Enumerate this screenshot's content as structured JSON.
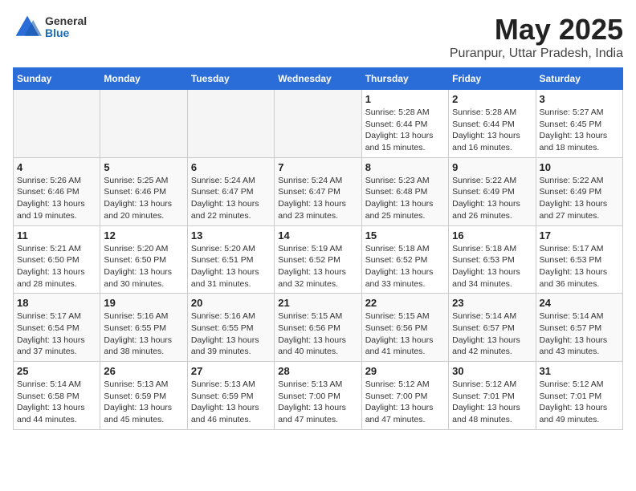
{
  "header": {
    "logo_general": "General",
    "logo_blue": "Blue",
    "month": "May 2025",
    "location": "Puranpur, Uttar Pradesh, India"
  },
  "weekdays": [
    "Sunday",
    "Monday",
    "Tuesday",
    "Wednesday",
    "Thursday",
    "Friday",
    "Saturday"
  ],
  "weeks": [
    [
      {
        "day": "",
        "info": ""
      },
      {
        "day": "",
        "info": ""
      },
      {
        "day": "",
        "info": ""
      },
      {
        "day": "",
        "info": ""
      },
      {
        "day": "1",
        "info": "Sunrise: 5:28 AM\nSunset: 6:44 PM\nDaylight: 13 hours\nand 15 minutes."
      },
      {
        "day": "2",
        "info": "Sunrise: 5:28 AM\nSunset: 6:44 PM\nDaylight: 13 hours\nand 16 minutes."
      },
      {
        "day": "3",
        "info": "Sunrise: 5:27 AM\nSunset: 6:45 PM\nDaylight: 13 hours\nand 18 minutes."
      }
    ],
    [
      {
        "day": "4",
        "info": "Sunrise: 5:26 AM\nSunset: 6:46 PM\nDaylight: 13 hours\nand 19 minutes."
      },
      {
        "day": "5",
        "info": "Sunrise: 5:25 AM\nSunset: 6:46 PM\nDaylight: 13 hours\nand 20 minutes."
      },
      {
        "day": "6",
        "info": "Sunrise: 5:24 AM\nSunset: 6:47 PM\nDaylight: 13 hours\nand 22 minutes."
      },
      {
        "day": "7",
        "info": "Sunrise: 5:24 AM\nSunset: 6:47 PM\nDaylight: 13 hours\nand 23 minutes."
      },
      {
        "day": "8",
        "info": "Sunrise: 5:23 AM\nSunset: 6:48 PM\nDaylight: 13 hours\nand 25 minutes."
      },
      {
        "day": "9",
        "info": "Sunrise: 5:22 AM\nSunset: 6:49 PM\nDaylight: 13 hours\nand 26 minutes."
      },
      {
        "day": "10",
        "info": "Sunrise: 5:22 AM\nSunset: 6:49 PM\nDaylight: 13 hours\nand 27 minutes."
      }
    ],
    [
      {
        "day": "11",
        "info": "Sunrise: 5:21 AM\nSunset: 6:50 PM\nDaylight: 13 hours\nand 28 minutes."
      },
      {
        "day": "12",
        "info": "Sunrise: 5:20 AM\nSunset: 6:50 PM\nDaylight: 13 hours\nand 30 minutes."
      },
      {
        "day": "13",
        "info": "Sunrise: 5:20 AM\nSunset: 6:51 PM\nDaylight: 13 hours\nand 31 minutes."
      },
      {
        "day": "14",
        "info": "Sunrise: 5:19 AM\nSunset: 6:52 PM\nDaylight: 13 hours\nand 32 minutes."
      },
      {
        "day": "15",
        "info": "Sunrise: 5:18 AM\nSunset: 6:52 PM\nDaylight: 13 hours\nand 33 minutes."
      },
      {
        "day": "16",
        "info": "Sunrise: 5:18 AM\nSunset: 6:53 PM\nDaylight: 13 hours\nand 34 minutes."
      },
      {
        "day": "17",
        "info": "Sunrise: 5:17 AM\nSunset: 6:53 PM\nDaylight: 13 hours\nand 36 minutes."
      }
    ],
    [
      {
        "day": "18",
        "info": "Sunrise: 5:17 AM\nSunset: 6:54 PM\nDaylight: 13 hours\nand 37 minutes."
      },
      {
        "day": "19",
        "info": "Sunrise: 5:16 AM\nSunset: 6:55 PM\nDaylight: 13 hours\nand 38 minutes."
      },
      {
        "day": "20",
        "info": "Sunrise: 5:16 AM\nSunset: 6:55 PM\nDaylight: 13 hours\nand 39 minutes."
      },
      {
        "day": "21",
        "info": "Sunrise: 5:15 AM\nSunset: 6:56 PM\nDaylight: 13 hours\nand 40 minutes."
      },
      {
        "day": "22",
        "info": "Sunrise: 5:15 AM\nSunset: 6:56 PM\nDaylight: 13 hours\nand 41 minutes."
      },
      {
        "day": "23",
        "info": "Sunrise: 5:14 AM\nSunset: 6:57 PM\nDaylight: 13 hours\nand 42 minutes."
      },
      {
        "day": "24",
        "info": "Sunrise: 5:14 AM\nSunset: 6:57 PM\nDaylight: 13 hours\nand 43 minutes."
      }
    ],
    [
      {
        "day": "25",
        "info": "Sunrise: 5:14 AM\nSunset: 6:58 PM\nDaylight: 13 hours\nand 44 minutes."
      },
      {
        "day": "26",
        "info": "Sunrise: 5:13 AM\nSunset: 6:59 PM\nDaylight: 13 hours\nand 45 minutes."
      },
      {
        "day": "27",
        "info": "Sunrise: 5:13 AM\nSunset: 6:59 PM\nDaylight: 13 hours\nand 46 minutes."
      },
      {
        "day": "28",
        "info": "Sunrise: 5:13 AM\nSunset: 7:00 PM\nDaylight: 13 hours\nand 47 minutes."
      },
      {
        "day": "29",
        "info": "Sunrise: 5:12 AM\nSunset: 7:00 PM\nDaylight: 13 hours\nand 47 minutes."
      },
      {
        "day": "30",
        "info": "Sunrise: 5:12 AM\nSunset: 7:01 PM\nDaylight: 13 hours\nand 48 minutes."
      },
      {
        "day": "31",
        "info": "Sunrise: 5:12 AM\nSunset: 7:01 PM\nDaylight: 13 hours\nand 49 minutes."
      }
    ]
  ]
}
